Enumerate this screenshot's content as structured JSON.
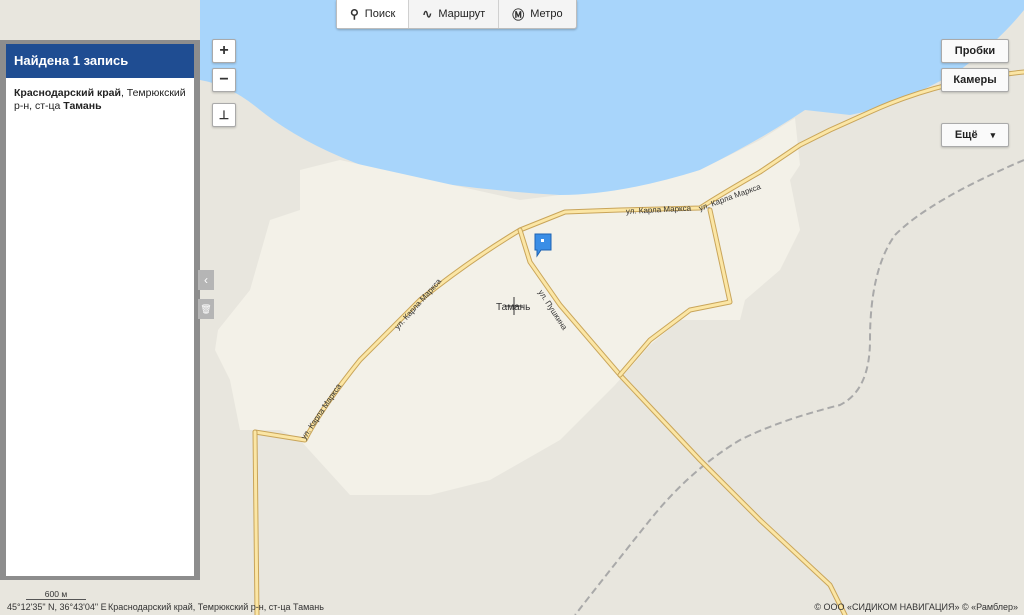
{
  "tabs": [
    {
      "label": "Поиск",
      "icon": "search-icon"
    },
    {
      "label": "Маршрут",
      "icon": "route-icon"
    },
    {
      "label": "Метро",
      "icon": "metro-icon"
    }
  ],
  "results_panel": {
    "title": "Найдена 1 запись",
    "result": {
      "region": "Краснодарский край",
      "district": ", Темрюкский р-н, ст-ца ",
      "place": "Тамань"
    }
  },
  "controls": {
    "zoom_in": "+",
    "zoom_out": "−",
    "ruler": "⊥",
    "collapse": "‹",
    "trash": "🗑"
  },
  "right_buttons": {
    "traffic": "Пробки",
    "cameras": "Камеры",
    "more": "Ещё",
    "more_arrow": "▾"
  },
  "map": {
    "streets": {
      "marx1": "ул. Карла Маркса",
      "marx2": "ул. Карла Маркса",
      "marx3": "ул. Карла Маркса",
      "marx4": "ул. Карла Маркса",
      "pushkina": "ул. Пушкина"
    },
    "town_label": "Тамань",
    "colors": {
      "water": "#a8d5fb",
      "land": "#e8e6de",
      "settlement": "#f3f1e8",
      "road": "#e2be6c",
      "railway": "#a9a9a9",
      "marker": "#3a8ee6",
      "panel_header": "#1f4d92"
    }
  },
  "scale_label": "600 м",
  "status": {
    "coords": "45°12'35\" N, 36°43'04\" E",
    "address": "Краснодарский край, Темрюкский р-н, ст-ца Тамань",
    "copyright": "© ООО «СИДИКОМ НАВИГАЦИЯ» © «Рамблер»"
  }
}
